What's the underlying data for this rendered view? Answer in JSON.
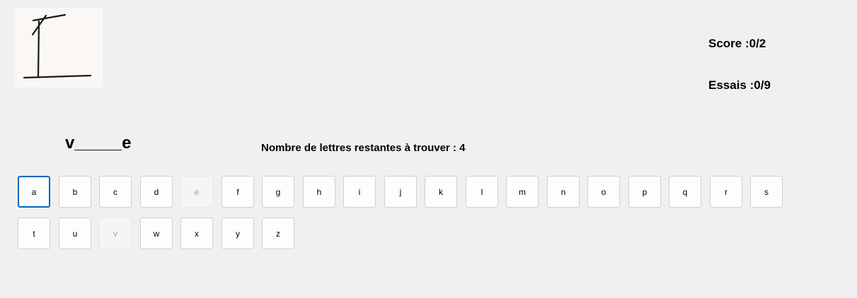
{
  "stats": {
    "score": "Score :0/2",
    "attempts": "Essais :0/9"
  },
  "word_display": "v_____e",
  "remaining_text": "Nombre de lettres restantes à trouver : 4",
  "hangman_stage_icon": "hangman-gallows-icon",
  "keyboard": {
    "rows": [
      [
        "a",
        "b",
        "c",
        "d",
        "e",
        "f",
        "g",
        "h",
        "i",
        "j",
        "k",
        "l",
        "m",
        "n",
        "o",
        "p",
        "q",
        "r",
        "s"
      ],
      [
        "t",
        "u",
        "v",
        "w",
        "x",
        "y",
        "z"
      ]
    ],
    "used_letters": [
      "e",
      "v"
    ],
    "focused_letter": "a"
  }
}
